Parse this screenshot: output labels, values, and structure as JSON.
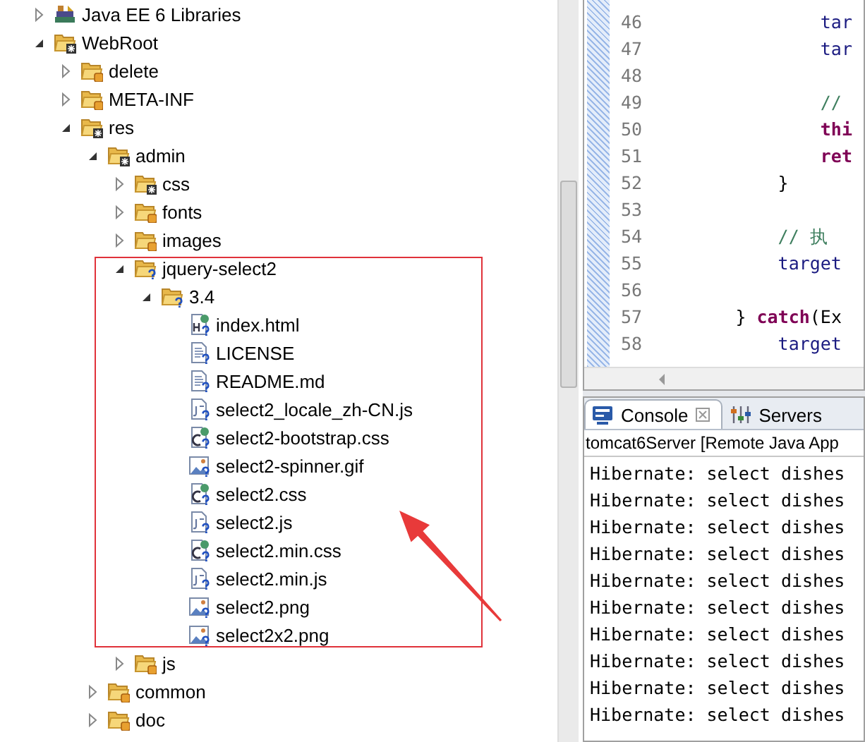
{
  "project_tree": {
    "items": [
      {
        "label": "Java EE 6 Libraries",
        "kind": "library",
        "expanded": false
      },
      {
        "label": "WebRoot",
        "kind": "changed-folder",
        "expanded": true,
        "children": [
          {
            "label": "delete",
            "kind": "versioned-folder",
            "expanded": false
          },
          {
            "label": "META-INF",
            "kind": "versioned-folder",
            "expanded": false
          },
          {
            "label": "res",
            "kind": "changed-folder",
            "expanded": true,
            "children": [
              {
                "label": "admin",
                "kind": "changed-folder",
                "expanded": true,
                "children": [
                  {
                    "label": "css",
                    "kind": "changed-folder",
                    "expanded": false
                  },
                  {
                    "label": "fonts",
                    "kind": "versioned-folder",
                    "expanded": false
                  },
                  {
                    "label": "images",
                    "kind": "versioned-folder",
                    "expanded": false
                  },
                  {
                    "label": "jquery-select2",
                    "kind": "new-folder",
                    "expanded": true,
                    "children": [
                      {
                        "label": "3.4",
                        "kind": "new-folder",
                        "expanded": true,
                        "children": [
                          {
                            "label": "index.html",
                            "kind": "html"
                          },
                          {
                            "label": "LICENSE",
                            "kind": "text"
                          },
                          {
                            "label": "README.md",
                            "kind": "text"
                          },
                          {
                            "label": "select2_locale_zh-CN.js",
                            "kind": "js"
                          },
                          {
                            "label": "select2-bootstrap.css",
                            "kind": "css"
                          },
                          {
                            "label": "select2-spinner.gif",
                            "kind": "image"
                          },
                          {
                            "label": "select2.css",
                            "kind": "css"
                          },
                          {
                            "label": "select2.js",
                            "kind": "js"
                          },
                          {
                            "label": "select2.min.css",
                            "kind": "css"
                          },
                          {
                            "label": "select2.min.js",
                            "kind": "js"
                          },
                          {
                            "label": "select2.png",
                            "kind": "image"
                          },
                          {
                            "label": "select2x2.png",
                            "kind": "image"
                          }
                        ]
                      }
                    ]
                  },
                  {
                    "label": "js",
                    "kind": "versioned-folder",
                    "expanded": false
                  }
                ]
              },
              {
                "label": "common",
                "kind": "versioned-folder",
                "expanded": false
              },
              {
                "label": "doc",
                "kind": "versioned-folder",
                "expanded": false
              }
            ]
          }
        ]
      }
    ]
  },
  "editor": {
    "lines": [
      {
        "number": "46",
        "tokens": [
          {
            "kind": "variable",
            "text": "                tar"
          }
        ]
      },
      {
        "number": "47",
        "tokens": [
          {
            "kind": "variable",
            "text": "                tar"
          }
        ]
      },
      {
        "number": "48"
      },
      {
        "number": "49",
        "tokens": [
          {
            "kind": "comment",
            "text": "                //"
          }
        ]
      },
      {
        "number": "50",
        "tokens": [
          {
            "kind": "keyword",
            "text": "                thi"
          }
        ]
      },
      {
        "number": "51",
        "tokens": [
          {
            "kind": "keyword",
            "text": "                ret"
          }
        ]
      },
      {
        "number": "52",
        "tokens": [
          {
            "kind": "plain",
            "text": "            }"
          }
        ]
      },
      {
        "number": "53"
      },
      {
        "number": "54",
        "tokens": [
          {
            "kind": "comment",
            "text": "            // 执"
          }
        ]
      },
      {
        "number": "55",
        "tokens": [
          {
            "kind": "variable",
            "text": "            target"
          }
        ]
      },
      {
        "number": "56"
      },
      {
        "number": "57",
        "tokens": [
          {
            "kind": "plain",
            "text": "        } "
          },
          {
            "kind": "keyword",
            "text": "catch"
          },
          {
            "kind": "plain",
            "text": "(Ex"
          }
        ]
      },
      {
        "number": "58",
        "tokens": [
          {
            "kind": "variable",
            "text": "            target"
          }
        ]
      }
    ]
  },
  "console": {
    "tabs": [
      {
        "label": "Console",
        "kind": "console",
        "selected": true
      },
      {
        "label": "Servers",
        "kind": "servers",
        "selected": false
      }
    ],
    "description": "tomcat6Server [Remote Java App",
    "lines": [
      "Hibernate: select dishes",
      "Hibernate: select dishes",
      "Hibernate: select dishes",
      "Hibernate: select dishes",
      "Hibernate: select dishes",
      "Hibernate: select dishes",
      "Hibernate: select dishes",
      "Hibernate: select dishes",
      "Hibernate: select dishes",
      "Hibernate: select dishes"
    ]
  }
}
